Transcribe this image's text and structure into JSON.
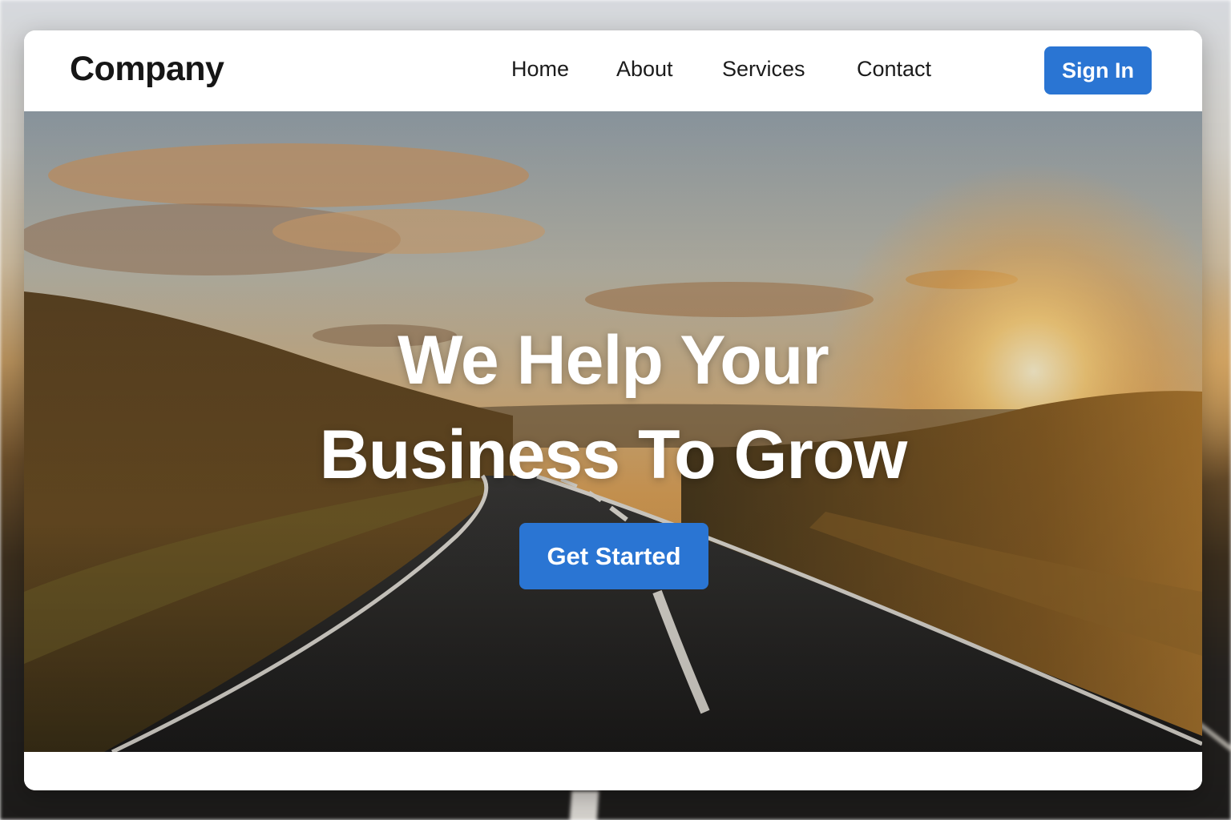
{
  "brand": "Company",
  "nav": {
    "links": [
      "Home",
      "About",
      "Services",
      "Contact"
    ],
    "sign_in": "Sign In"
  },
  "hero": {
    "title_line1": "We Help Your",
    "title_line2": "Business To Grow",
    "cta": "Get Started",
    "background": "sunset-road-landscape"
  },
  "colors": {
    "accent": "#2a75d3",
    "text": "#161616",
    "hero_text": "#ffffff"
  }
}
